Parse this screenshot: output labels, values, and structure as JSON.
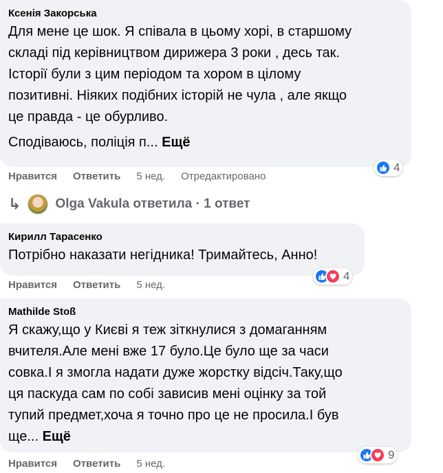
{
  "comments": [
    {
      "author": "Ксенія Закорська",
      "lines": [
        "Для мене це шок. Я співала в цьому хорі, в старшому",
        "складі під керівництвом дирижера 3 роки , десь так.",
        "Історії були з цим періодом та хором в цілому",
        "позитивні. Ніяких подібних історій не чула , але якщо",
        "це правда - це обурливо."
      ],
      "truncated_line": "Сподіваюсь, поліція п...",
      "more_label": "Ещё",
      "like_label": "Нравится",
      "reply_label": "Ответить",
      "time": "5 нед.",
      "edited_label": "Отредактировано",
      "reaction_count": "4",
      "reactions": [
        "like-icon"
      ]
    },
    {
      "author": "Кирилл Тарасенко",
      "lines": [
        "Потрібно наказати негідника! Тримайтесь, Анно!"
      ],
      "like_label": "Нравится",
      "reply_label": "Ответить",
      "time": "5 нед.",
      "reaction_count": "4",
      "reactions": [
        "like-icon",
        "love-icon"
      ]
    },
    {
      "author": "Mathilde Stoß",
      "lines": [
        "Я скажу,що у Києві я теж зіткнулися з домаганням",
        "вчителя.Але мені вже 17 було.Це було ще за часи",
        "совка.І я змогла надати дуже жорстку відсіч.Таку,що",
        "ця паскуда сам по собі зависив мені оцінку за той",
        "тупий предмет,хоча я точно про це не просила.І був"
      ],
      "truncated_line": "ще...",
      "more_label": "Ещё",
      "like_label": "Нравится",
      "reply_label": "Ответить",
      "time": "5 нед.",
      "reaction_count": "9",
      "reactions": [
        "like-icon",
        "love-icon"
      ]
    }
  ],
  "reply_thread": {
    "text": "Olga Vakula ответила · 1 ответ",
    "icon": "reply-arrow-icon"
  },
  "colors": {
    "bubble": "#f0f2f5",
    "meta": "#65676b",
    "like": "#1877f2",
    "love": "#f33e58"
  }
}
